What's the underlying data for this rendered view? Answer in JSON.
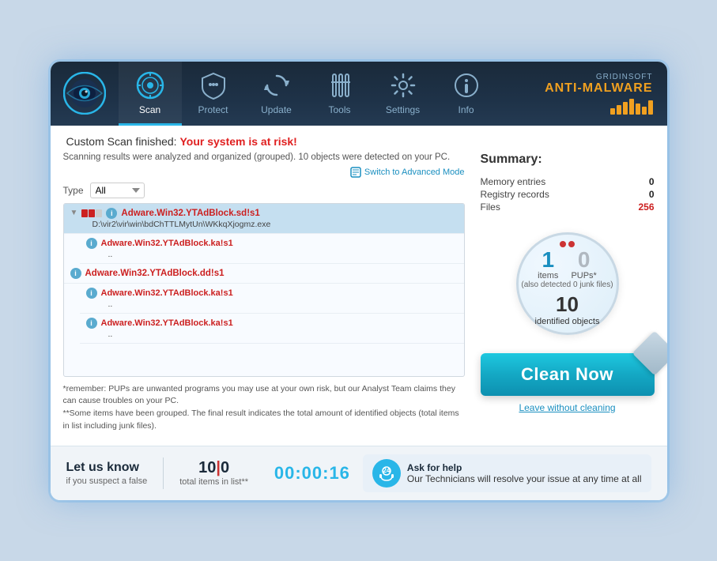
{
  "brand": {
    "top": "GRIDINSOFT",
    "main": "ANTI-MALWARE"
  },
  "nav": {
    "tabs": [
      {
        "id": "scan",
        "label": "Scan",
        "active": true
      },
      {
        "id": "protect",
        "label": "Protect",
        "active": false
      },
      {
        "id": "update",
        "label": "Update",
        "active": false
      },
      {
        "id": "tools",
        "label": "Tools",
        "active": false
      },
      {
        "id": "settings",
        "label": "Settings",
        "active": false
      },
      {
        "id": "info",
        "label": "Info",
        "active": false
      }
    ]
  },
  "scan": {
    "title_prefix": "Custom Scan finished: ",
    "title_risk": "Your system is at risk!",
    "info_text": "Scanning results were analyzed and organized (grouped). 10 objects were detected on your PC.",
    "switch_link": "Switch to Advanced Mode",
    "filter_label": "Type",
    "filter_value": "All",
    "results": [
      {
        "id": 1,
        "name": "Adware.Win32.YTAdBlock.sdls1",
        "path": "D:\\vir2\\vir\\win\\bdChTTLMytUn\\WKkqXjogmz.exe",
        "selected": true,
        "has_expand": true,
        "threat_level": "high"
      },
      {
        "id": 2,
        "name": "Adware.Win32.YTAdBlock.ka!s1",
        "path": "..",
        "selected": false,
        "has_expand": false,
        "threat_level": "high",
        "sub": true
      },
      {
        "id": 3,
        "name": "Adware.Win32.YTAdBlock.dd!s1",
        "path": "",
        "selected": false,
        "has_expand": false,
        "threat_level": "high"
      },
      {
        "id": 4,
        "name": "Adware.Win32.YTAdBlock.ka!s1",
        "path": "..",
        "selected": false,
        "has_expand": false,
        "threat_level": "high",
        "sub": true
      },
      {
        "id": 5,
        "name": "Adware.Win32.YTAdBlock.ka!s1",
        "path": "..",
        "selected": false,
        "has_expand": false,
        "threat_level": "high",
        "sub": true
      }
    ],
    "footnote1": "*remember: PUPs are unwanted programs you may use at your own risk, but our Analyst Team claims they can cause troubles on your PC.",
    "footnote2": "**Some items have been grouped. The final result indicates the total amount of identified objects (total items in list including junk files)."
  },
  "summary": {
    "title": "Summary:",
    "memory_label": "Memory entries",
    "memory_val": "0",
    "registry_label": "Registry records",
    "registry_val": "0",
    "files_label": "Files",
    "files_val": "256",
    "items_num": "1",
    "items_label": "items",
    "pups_num": "0",
    "pups_label": "PUPs*",
    "junk_note": "(also detected 0 junk files)",
    "identified_num": "10",
    "identified_label": "identified objects",
    "clean_btn": "Clean Now",
    "leave_link": "Leave without cleaning"
  },
  "footer": {
    "let_us": "Let us know",
    "sub": "if you suspect a false",
    "count_main": "10",
    "count_sep": "|",
    "count_zero": "0",
    "count_label": "total items in list**",
    "timer": "00:00:16",
    "support_title": "Ask for help",
    "support_text": "Our Technicians will resolve your issue at any time at all"
  }
}
